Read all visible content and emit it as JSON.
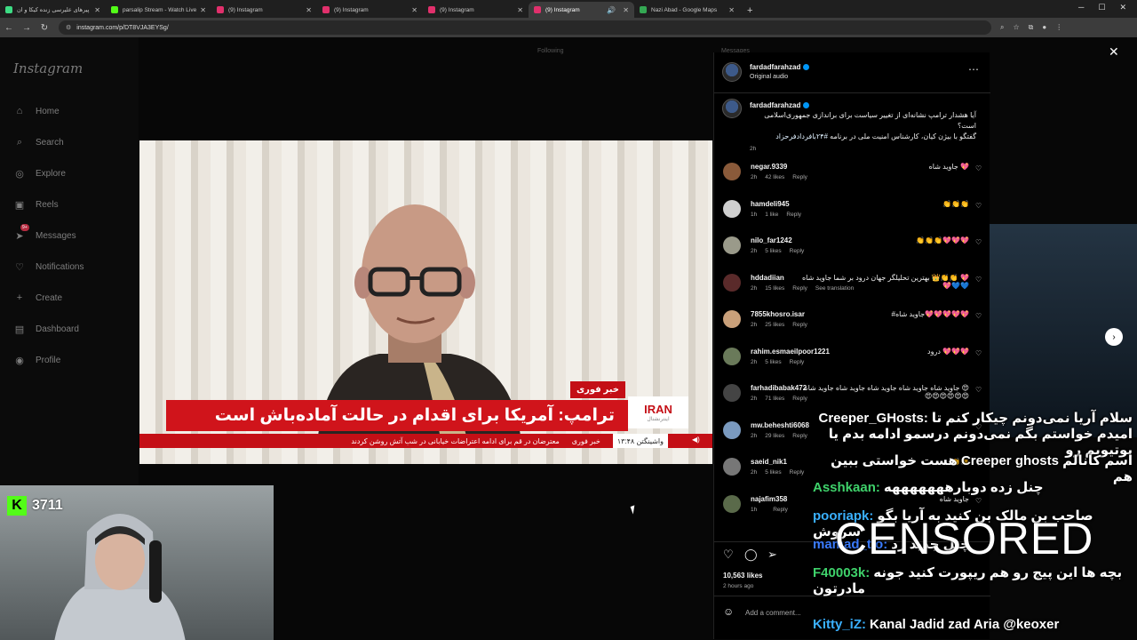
{
  "browser": {
    "tabs": [
      {
        "title": "اسل پیرهای علیرسی زنده کیکا و ان",
        "color": "#3ddc84"
      },
      {
        "title": "parsalip Stream - Watch Live o",
        "color": "#53fc18"
      },
      {
        "title": "(9) Instagram",
        "color": "#e1306c"
      },
      {
        "title": "(9) Instagram",
        "color": "#e1306c"
      },
      {
        "title": "(9) Instagram",
        "color": "#e1306c"
      },
      {
        "title": "(9) Instagram",
        "color": "#e1306c"
      },
      {
        "title": "Nazi Abad - Google Maps",
        "color": "#34a853"
      }
    ],
    "url": "instagram.com/p/DT8VJA3EYSg/"
  },
  "sidebar": {
    "logo": "Instagram",
    "items": [
      {
        "label": "Home",
        "icon": "home-icon"
      },
      {
        "label": "Search",
        "icon": "search-icon"
      },
      {
        "label": "Explore",
        "icon": "explore-icon"
      },
      {
        "label": "Reels",
        "icon": "reels-icon"
      },
      {
        "label": "Messages",
        "icon": "messages-icon"
      },
      {
        "label": "Notifications",
        "icon": "heart-icon"
      },
      {
        "label": "Create",
        "icon": "plus-icon"
      },
      {
        "label": "Dashboard",
        "icon": "dashboard-icon"
      },
      {
        "label": "Profile",
        "icon": "profile-icon"
      }
    ],
    "messages_badge": "9+"
  },
  "top_labels": {
    "following": "Following",
    "messages": "Messages"
  },
  "video": {
    "breaking_tag": "خبر فوری",
    "headline": "ترامپ: آمریکا برای اقدام در حالت آماده‌باش است",
    "channel_name": "IRAN",
    "channel_sub": "اینترنشنال",
    "ticker_time": "واشینگتن ۱۳:۴۸",
    "ticker_tag": "خبر فوری",
    "ticker_text": "معترضان در قم برای ادامه اعتراضات خیابانی در شب آتش روشن کردند"
  },
  "post": {
    "author": "fardadfarahzad",
    "audio": "Original audio",
    "caption_line1": "آیا هشدار ترامپ نشانه‌ای از تغییر سیاست برای براندازی جمهوری‌اسلامی است؟",
    "caption_line2": "گفتگو با بیژن کیان، کارشناس امنیت ملی در برنامه",
    "caption_hashtag": "#۲۴بافرداد‌فرحزاد",
    "caption_time": "2h",
    "comments": [
      {
        "user": "negar.9339",
        "text": "جاوید شاه 💖",
        "time": "2h",
        "likes": "42 likes",
        "extra": "",
        "avatar": "#8a5a3a"
      },
      {
        "user": "hamdeli945",
        "text": "👏👏👏",
        "time": "1h",
        "likes": "1 like",
        "extra": "",
        "avatar": "#cfcfcf"
      },
      {
        "user": "nilo_far1242",
        "text": "👏👏👏💖💖💖",
        "time": "2h",
        "likes": "5 likes",
        "extra": "",
        "avatar": "#9a9a8a"
      },
      {
        "user": "hddadiian",
        "text": "بهترین تحلیلگر جهان درود بر شما جاوید شاه 👑👏👏 💖💖💙💙",
        "time": "2h",
        "likes": "15 likes",
        "extra": "See translation",
        "avatar": "#5a2a2a"
      },
      {
        "user": "7855khosro.isar",
        "text": "#جاوید شاه💖💖💖💖💖",
        "time": "2h",
        "likes": "25 likes",
        "extra": "",
        "avatar": "#c9a07a"
      },
      {
        "user": "rahim.esmaeilpoor1221",
        "text": "درود 💖💖💖",
        "time": "2h",
        "likes": "5 likes",
        "extra": "",
        "avatar": "#6a7a5a"
      },
      {
        "user": "farhadibabak472",
        "text": "جاوید شاه جاوید شاه جاوید شاه جاوید شاه جاوید شاه 😍😍😍😍😍😍😍",
        "time": "2h",
        "likes": "71 likes",
        "extra": "",
        "avatar": "#444"
      },
      {
        "user": "mw.beheshti6068",
        "text": "",
        "time": "2h",
        "likes": "29 likes",
        "extra": "",
        "avatar": "#7a9abf"
      },
      {
        "user": "saeid_nik1",
        "text": "👏👏",
        "time": "2h",
        "likes": "5 likes",
        "extra": "",
        "avatar": "#777"
      },
      {
        "user": "najafim358",
        "text": "جاوید شاه",
        "time": "1h",
        "likes": "",
        "extra": "",
        "avatar": "#5a6a4a"
      }
    ],
    "likes": "10,563 likes",
    "ago": "2 hours ago",
    "add_comment_placeholder": "Add a comment..."
  },
  "stream": {
    "kick_count": "3711",
    "censored_label": "CENSORED",
    "chat": [
      {
        "user": "Creeper_GHosts:",
        "text": "سلام آریا نمی‌دونم چیکار کنم تا امیدم خواستم بگم نمی‌دونم درسمو ادامه بدم یا یوتیوبم رو",
        "user_color": "#ffffff"
      },
      {
        "user": "",
        "text": "هست خواستی ببین Creeper ghosts اسم کانالم هم",
        "user_color": "#ffffff"
      },
      {
        "user": "Asshkaan:",
        "text": "چنل زده دوبارهههههههه",
        "user_color": "#3fd26b"
      },
      {
        "user": "pooriapk:",
        "text": "صاحب بن مالک بن کنید به آریا بگو سروش",
        "user_color": "#3ab0ff"
      },
      {
        "user": "mamad_tio:",
        "text": "چنل جدید زد",
        "user_color": "#3a7bff"
      },
      {
        "user": "F40003k:",
        "text": "بچه ها این پیج رو هم ریپورت کنید جونه مادرتون",
        "user_color": "#3fd26b"
      },
      {
        "user": "Kitty_iZ:",
        "text": "Kanal Jadid zad Aria @keoxer",
        "user_color": "#3ab0ff"
      }
    ]
  }
}
